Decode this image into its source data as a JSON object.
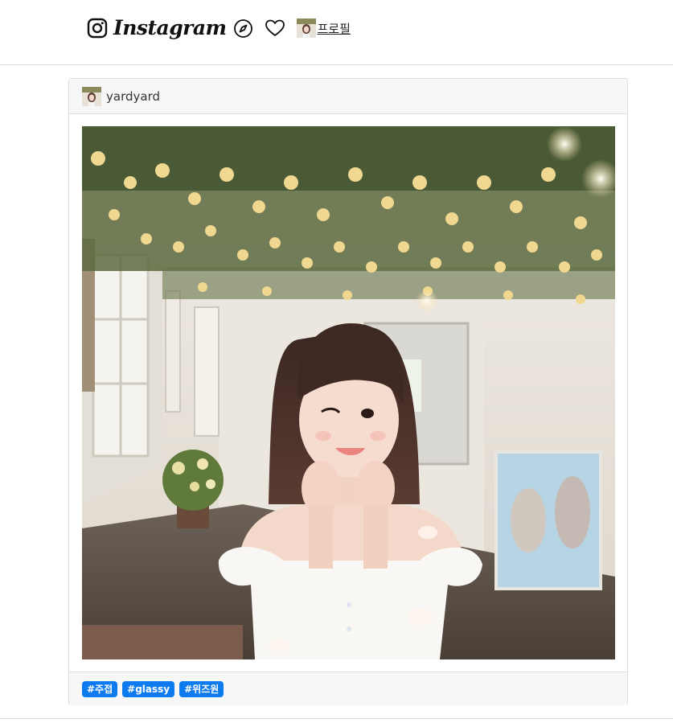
{
  "nav": {
    "brand": "Instagram",
    "profile_label": " 프로필"
  },
  "post": {
    "username": "yardyard",
    "tags": [
      "#주접",
      "#glassy",
      "#위즈원"
    ]
  },
  "icons": {
    "logo": "instagram-icon",
    "explore": "compass-icon",
    "activity": "heart-icon",
    "avatar": "avatar"
  }
}
